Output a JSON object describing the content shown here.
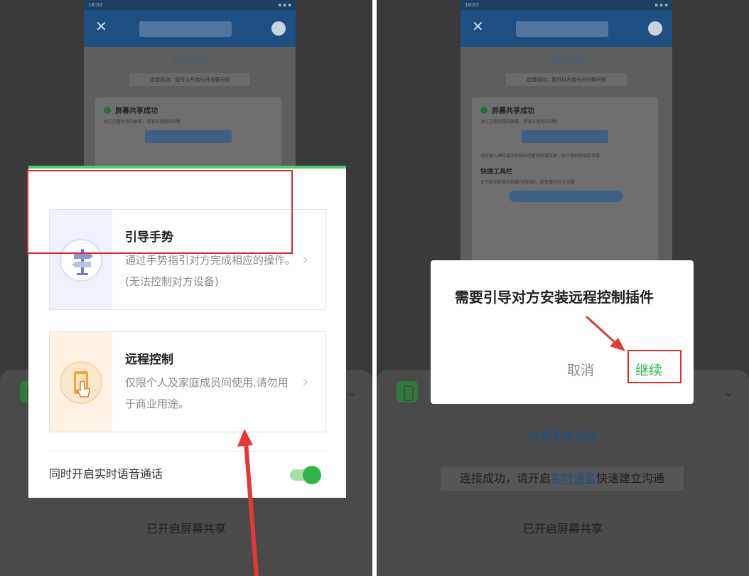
{
  "left_dialog": {
    "option_gesture": {
      "title": "引导手势",
      "description": "通过手势指引对方完成相应的操作。(无法控制对方设备)",
      "arrow": "›",
      "icon": "signpost-icon"
    },
    "option_remote": {
      "title": "远程控制",
      "description": "仅限个人及家庭成员间使用,请勿用于商业用途。",
      "arrow": "›",
      "icon": "phone-touch-icon"
    },
    "voice_toggle": {
      "label": "同时开启实时语音通话",
      "on": true
    },
    "accent_color": "#4cd06a"
  },
  "right_dialog": {
    "message": "需要引导对方安装远程控制插件",
    "cancel_label": "取消",
    "continue_label": "继续"
  },
  "background_screen": {
    "status_time": "18:02",
    "close_symbol": "✕",
    "more_messages": "查看更多消息",
    "connected_notice": "连接成功，您可以开始与对方聊天啦",
    "share_success_title": "屏幕共享成功",
    "share_success_desc": "对方已看到您的屏幕，请演示遇到的问题",
    "privacy_tip": "请在输入密码或涉及隐私时暂停屏幕共享，防止密码等隐私泄露",
    "toolbar_title": "快捷工具栏",
    "toolbar_desc": "在不影响您演示和操作的同时，能快速与对方沟通"
  },
  "bottom_sheet": {
    "chevron": "⌄",
    "more_messages": "查看更多消息",
    "connect_prefix": "连接成功，请开启",
    "connect_link": "实时语音",
    "connect_suffix": "快速建立沟通",
    "screen_share_status": "已开启屏幕共享"
  },
  "colors": {
    "highlight_red": "#d32f2f",
    "green": "#2fb54a",
    "app_blue": "#1e4f83"
  }
}
